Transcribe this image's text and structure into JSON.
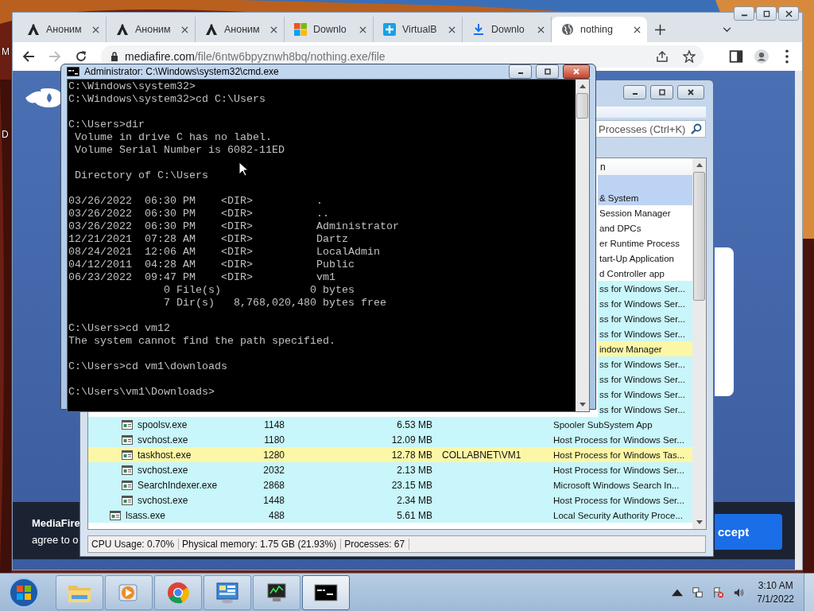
{
  "desktop": {
    "labels": [
      "M",
      "D"
    ]
  },
  "browser": {
    "tabs": [
      {
        "kind": "anon",
        "title": "Аноним",
        "selected": false
      },
      {
        "kind": "anon",
        "title": "Аноним",
        "selected": false
      },
      {
        "kind": "anon",
        "title": "Аноним",
        "selected": false
      },
      {
        "kind": "windows",
        "title": "Downlo",
        "selected": false
      },
      {
        "kind": "virtualbox",
        "title": "VirtualB",
        "selected": false
      },
      {
        "kind": "download",
        "title": "Downlo",
        "selected": false
      },
      {
        "kind": "globe",
        "title": "nothing",
        "selected": true
      }
    ],
    "forward_enabled": false,
    "host": "mediafire.com",
    "path": "/file/6ntw6bpyznwh8bq/nothing.exe/file"
  },
  "page": {
    "footer_title": "MediaFire",
    "footer_text": "agree to o",
    "accept": "ccept"
  },
  "taskmgr": {
    "search_placeholder": "Processes (Ctrl+K)",
    "column_header": "n",
    "rows": [
      {
        "kind": "clipped",
        "selected": true
      },
      {
        "kind": "clipped",
        "desc": "& System",
        "selected": true
      },
      {
        "kind": "clipped",
        "desc": "Session Manager",
        "selected": false,
        "color": "#ffffff"
      },
      {
        "kind": "clipped",
        "desc": "and DPCs",
        "selected": false,
        "color": "#ffffff"
      },
      {
        "kind": "clipped",
        "desc": "er Runtime Process",
        "selected": false,
        "color": "#ffffff"
      },
      {
        "kind": "clipped",
        "desc": "tart-Up Application",
        "selected": false,
        "color": "#ffffff"
      },
      {
        "kind": "clipped",
        "desc": "d Controller app",
        "selected": false,
        "color": "#ffffff"
      },
      {
        "children": [
          {
            "kind": "clipped",
            "desc": "ss for Windows Ser...",
            "selected": false,
            "color": "#c8f6fa"
          },
          {
            "kind": "clipped",
            "desc": "ss for Windows Ser...",
            "selected": false,
            "color": "#c8f6fa"
          },
          {
            "kind": "clipped",
            "desc": "ss for Windows Ser...",
            "selected": false,
            "color": "#c8f6fa"
          },
          {
            "kind": "clipped",
            "desc": "ss for Windows Ser...",
            "selected": false,
            "color": "#c8f6fa"
          },
          {
            "kind": "clipped",
            "desc": "indow Manager",
            "selected": false,
            "color": "#fbf7a6"
          },
          {
            "kind": "clipped",
            "desc": "ss for Windows Ser...",
            "selected": false,
            "color": "#c8f6fa"
          },
          {
            "kind": "clipped",
            "desc": "ss for Windows Ser...",
            "selected": false,
            "color": "#c8f6fa"
          },
          {
            "kind": "clipped",
            "desc": "ss for Windows Ser...",
            "selected": false,
            "color": "#c8f6fa"
          },
          {
            "kind": "clipped",
            "desc": "ss for Windows Ser...",
            "selected": false,
            "color": "#c8f6fa"
          },
          {
            "kind": "full",
            "name": "spoolsv.exe",
            "pid": "1148",
            "memory": "6.53 MB",
            "desc": "Spooler SubSystem App",
            "selected": false,
            "color": "#c8f6fa"
          },
          {
            "kind": "full",
            "name": "svchost.exe",
            "pid": "1180",
            "memory": "12.09 MB",
            "desc": "Host Process for Windows Ser...",
            "selected": false,
            "color": "#c8f6fa"
          },
          {
            "kind": "full",
            "name": "taskhost.exe",
            "pid": "1280",
            "memory": "12.78 MB",
            "user": "COLLABNET\\VM1",
            "desc": "Host Process for Windows Tas...",
            "selected": false,
            "color": "#fbf7a6"
          },
          {
            "kind": "full",
            "name": "svchost.exe",
            "pid": "2032",
            "memory": "2.13 MB",
            "desc": "Host Process for Windows Ser...",
            "selected": false,
            "color": "#c8f6fa"
          },
          {
            "kind": "full",
            "name": "SearchIndexer.exe",
            "pid": "2868",
            "memory": "23.15 MB",
            "desc": "Microsoft Windows Search In...",
            "selected": false,
            "color": "#c8f6fa"
          },
          {
            "kind": "full",
            "name": "svchost.exe",
            "pid": "1448",
            "memory": "2.34 MB",
            "desc": "Host Process for Windows Ser...",
            "selected": false,
            "color": "#c8f6fa"
          }
        ]
      },
      {
        "kind": "full",
        "name": "lsass.exe",
        "pid": "488",
        "memory": "5.61 MB",
        "desc": "Local Security Authority Proce...",
        "selected": false,
        "color": "#c8f6fa"
      }
    ],
    "status": [
      "CPU Usage: 0.70%",
      "Physical memory: 1.75 GB (21.93%)",
      "Processes: 67"
    ]
  },
  "cmd": {
    "title": "Administrator: C:\\Windows\\system32\\cmd.exe",
    "blocks": [
      [
        "C:\\Windows\\system32>",
        "C:\\Windows\\system32>cd C:\\Users"
      ],
      [
        "C:\\Users>dir",
        " Volume in drive C has no label.",
        " Volume Serial Number is 6082-11ED"
      ],
      [
        " Directory of C:\\Users"
      ],
      [
        "03/26/2022  06:30 PM    <DIR>          .",
        "03/26/2022  06:30 PM    <DIR>          ..",
        "03/26/2022  06:30 PM    <DIR>          Administrator",
        "12/21/2021  07:28 AM    <DIR>          Dartz",
        "08/24/2021  12:06 AM    <DIR>          LocalAdmin",
        "04/12/2011  04:28 AM    <DIR>          Public",
        "06/23/2022  09:47 PM    <DIR>          vm1",
        "               0 File(s)              0 bytes",
        "               7 Dir(s)   8,768,020,480 bytes free"
      ],
      [
        "C:\\Users>cd vm12",
        "The system cannot find the path specified."
      ],
      [
        "C:\\Users>cd vm1\\downloads"
      ],
      [
        "C:\\Users\\vm1\\Downloads>"
      ]
    ]
  },
  "taskbar": {
    "apps": [
      {
        "kind": "explorer",
        "selected": false
      },
      {
        "kind": "media",
        "selected": false
      },
      {
        "kind": "chrome",
        "selected": false
      },
      {
        "kind": "panel",
        "selected": false
      },
      {
        "kind": "monitor",
        "selected": false
      },
      {
        "kind": "console",
        "selected": true
      }
    ],
    "time": "3:10 AM",
    "date": "7/1/2022"
  }
}
